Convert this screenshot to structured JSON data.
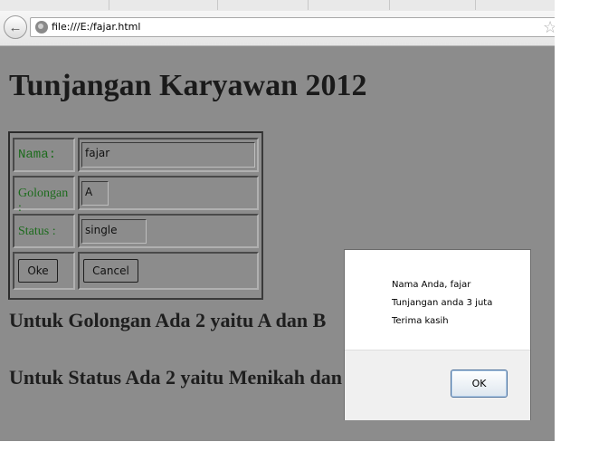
{
  "browser": {
    "url": "file:///E:/fajar.html"
  },
  "page": {
    "title": "Tunjangan Karyawan 2012",
    "form": {
      "nama_label": "Nama:",
      "nama_value": "fajar",
      "golongan_label": "Golongan :",
      "golongan_value": "A",
      "status_label": "Status :",
      "status_value": "single",
      "ok_label": "Oke",
      "cancel_label": "Cancel"
    },
    "paragraphs": [
      "Untuk Golongan Ada 2 yaitu A dan B",
      "Untuk Status Ada 2 yaitu Menikah dan"
    ]
  },
  "dialog": {
    "lines": [
      "Nama Anda, fajar",
      "Tunjangan anda 3 juta",
      "Terima kasih"
    ],
    "ok_label": "OK"
  },
  "icons": [
    "back-arrow-icon",
    "globe-icon",
    "bookmark-star-icon"
  ],
  "colors": {
    "page_bg": "#8c8c8c",
    "label_green": "#1c6b1c"
  }
}
